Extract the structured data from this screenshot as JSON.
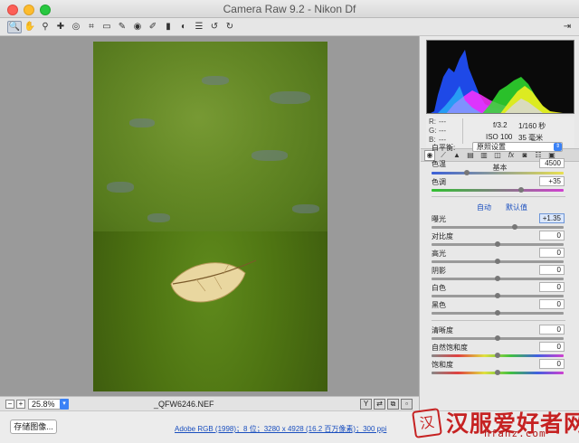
{
  "window": {
    "title": "Camera Raw 9.2  -  Nikon Df"
  },
  "toolbar": {
    "tools": [
      {
        "icon": "zoom-icon",
        "glyph": "🔍",
        "active": true
      },
      {
        "icon": "hand-icon",
        "glyph": "✋"
      },
      {
        "icon": "white-balance-icon",
        "glyph": "⚲"
      },
      {
        "icon": "color-sampler-icon",
        "glyph": "✚"
      },
      {
        "icon": "target-adjust-icon",
        "glyph": "◎"
      },
      {
        "icon": "crop-icon",
        "glyph": "⌗"
      },
      {
        "icon": "straighten-icon",
        "glyph": "▭"
      },
      {
        "icon": "spot-removal-icon",
        "glyph": "✎"
      },
      {
        "icon": "redeye-icon",
        "glyph": "◉"
      },
      {
        "icon": "brush-icon",
        "glyph": "✐"
      },
      {
        "icon": "graduated-filter-icon",
        "glyph": "▮"
      },
      {
        "icon": "radial-filter-icon",
        "glyph": "◐"
      },
      {
        "icon": "preferences-icon",
        "glyph": "☰"
      },
      {
        "icon": "rotate-ccw-icon",
        "glyph": "↺"
      },
      {
        "icon": "rotate-cw-icon",
        "glyph": "↻"
      }
    ],
    "right_icon": "export-icon"
  },
  "histogram": {
    "rgb_readout": {
      "r": "---",
      "g": "---",
      "b": "---"
    },
    "labels": {
      "r": "R:",
      "g": "G:",
      "b": "B:"
    },
    "exif": {
      "aperture": "f/3.2",
      "shutter": "1/160 秒",
      "iso": "ISO 100",
      "focal": "35 毫米"
    }
  },
  "panel_tabs": [
    "basic",
    "tone-curve",
    "detail",
    "hsl",
    "split-toning",
    "lens",
    "fx",
    "camera-calibration",
    "presets",
    "snapshots"
  ],
  "basic": {
    "section_title": "基本",
    "white_balance_label": "白平衡:",
    "white_balance_value": "原照设置",
    "temperature": {
      "label": "色温",
      "value": "4500",
      "level": 0.27
    },
    "tint": {
      "label": "色调",
      "value": "+35",
      "level": 0.68
    },
    "auto_label": "自动",
    "default_label": "默认值",
    "sliders": [
      {
        "name": "exposure",
        "label": "曝光",
        "value": "+1.35",
        "level": 0.63,
        "highlight": true
      },
      {
        "name": "contrast",
        "label": "对比度",
        "value": "0",
        "level": 0.5
      },
      {
        "name": "highlights",
        "label": "高光",
        "value": "0",
        "level": 0.5
      },
      {
        "name": "shadows",
        "label": "阴影",
        "value": "0",
        "level": 0.5
      },
      {
        "name": "whites",
        "label": "白色",
        "value": "0",
        "level": 0.5
      },
      {
        "name": "blacks",
        "label": "黑色",
        "value": "0",
        "level": 0.5
      }
    ],
    "sliders2": [
      {
        "name": "clarity",
        "label": "清晰度",
        "value": "0",
        "level": 0.5
      },
      {
        "name": "vibrance",
        "label": "自然饱和度",
        "value": "0",
        "level": 0.5
      },
      {
        "name": "saturation",
        "label": "饱和度",
        "value": "0",
        "level": 0.5
      }
    ]
  },
  "status": {
    "zoom": "25.8%",
    "filename": "_QFW6246.NEF"
  },
  "footer": {
    "save_label": "存储图像...",
    "workflow_link": "Adobe RGB (1998)；8 位；3280 x 4928 (16.2 百万像素)；300 ppi"
  },
  "watermark": {
    "seal": "汉",
    "text": "汉服爱好者网",
    "url": "hfahz.com"
  },
  "colors": {
    "accent": "#3b82f6",
    "link": "#1a4fbf",
    "watermark": "#c62222"
  }
}
